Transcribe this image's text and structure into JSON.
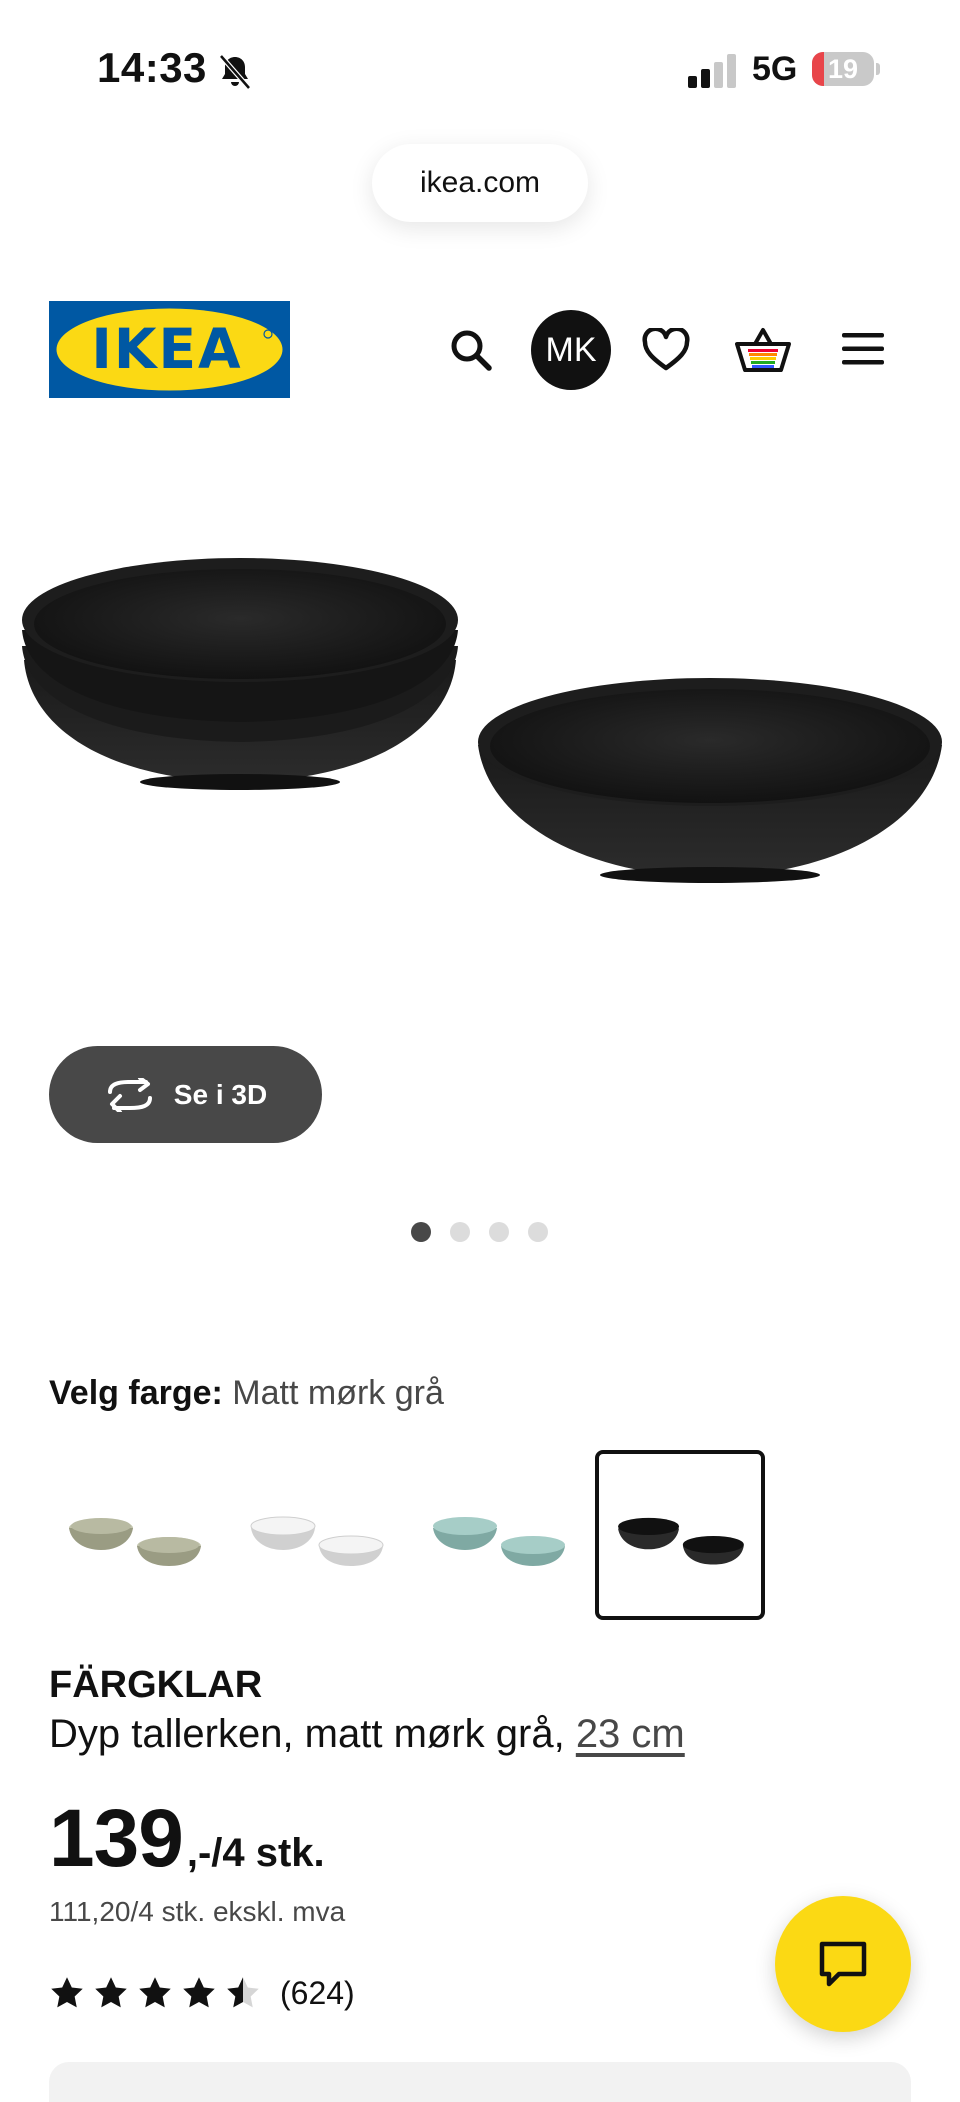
{
  "status_bar": {
    "time": "14:33",
    "network": "5G",
    "battery": "19",
    "battery_level": 0.19,
    "colors": {
      "battery_low": "#e8454a"
    }
  },
  "browser": {
    "url": "ikea.com"
  },
  "header": {
    "logo_text": "IKEA",
    "avatar_initials": "MK",
    "icons": [
      "search-icon",
      "avatar",
      "heart-icon",
      "cart-icon",
      "menu-icon"
    ],
    "colors": {
      "logo_blue": "#0058a3",
      "logo_yellow": "#fbd914"
    }
  },
  "gallery": {
    "view_3d_label": "Se i 3D",
    "dots": 4,
    "active_dot": 1
  },
  "color_picker": {
    "label": "Velg farge:",
    "value": "Matt mørk grå",
    "swatches": [
      {
        "name": "green",
        "color": "#9a9c83",
        "selected": false
      },
      {
        "name": "white",
        "color": "#e9e9e9",
        "selected": false
      },
      {
        "name": "turquoise",
        "color": "#8ab7b1",
        "selected": false
      },
      {
        "name": "dark-grey",
        "color": "#1c1c1c",
        "selected": true
      }
    ]
  },
  "product": {
    "name": "FÄRGKLAR",
    "description": "Dyp tallerken, matt mørk grå,",
    "size": "23 cm",
    "price_main": "139",
    "price_suffix": ",-/4 stk.",
    "price_ex_vat": "111,20/4 stk. ekskl. mva",
    "rating": 4.5,
    "reviews": "(624)"
  },
  "chat": {
    "icon": "chat-icon",
    "color": "#fbd914"
  }
}
